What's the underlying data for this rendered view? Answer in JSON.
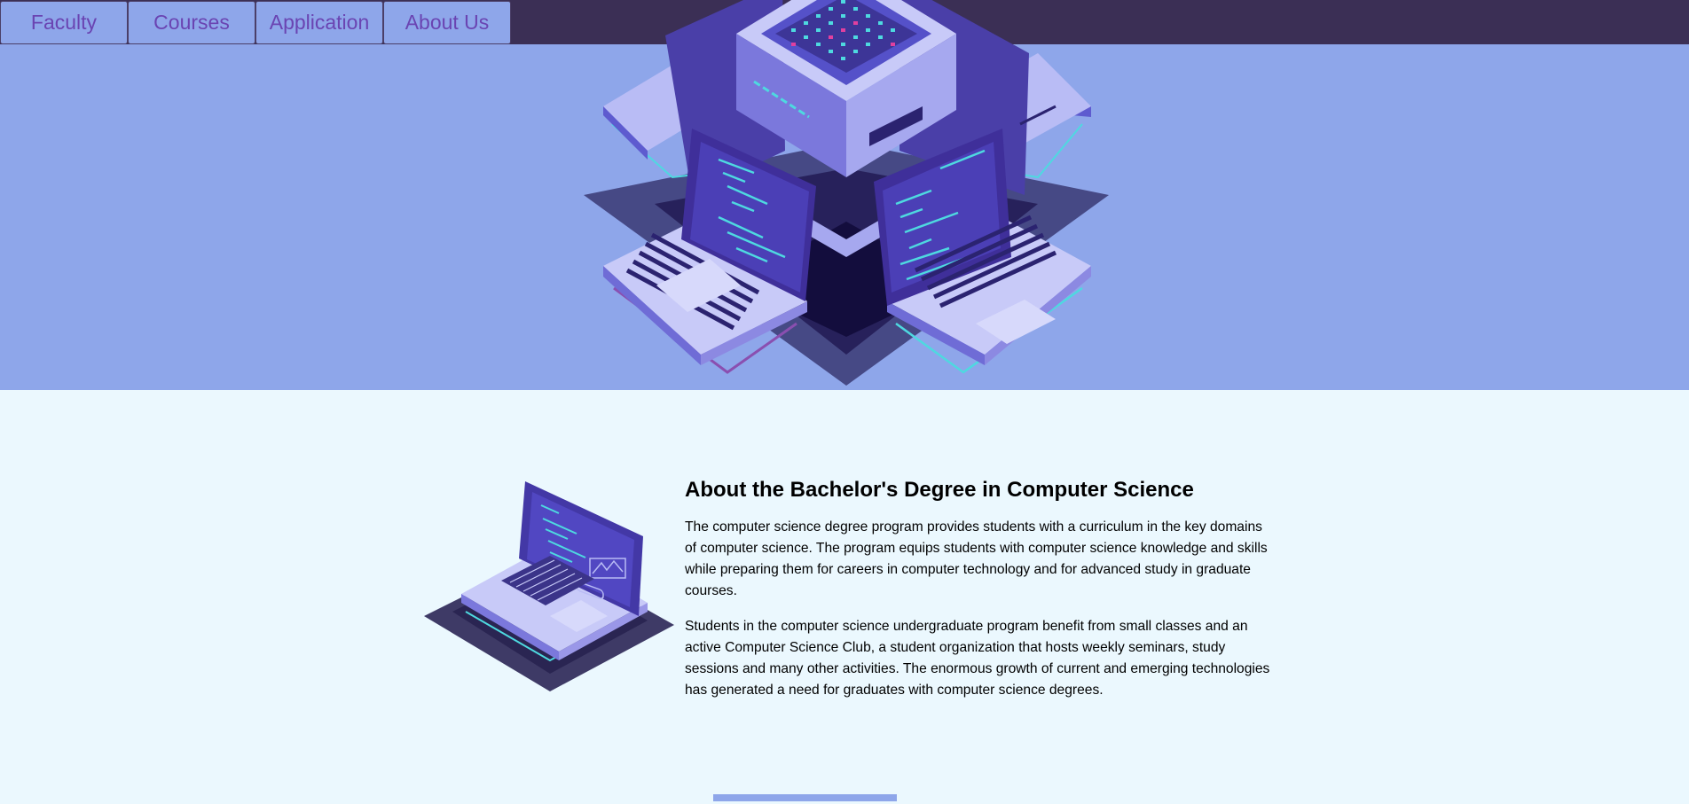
{
  "nav": {
    "items": [
      {
        "label": "Faculty"
      },
      {
        "label": "Courses"
      },
      {
        "label": "Application"
      },
      {
        "label": "About Us"
      }
    ]
  },
  "about": {
    "title": "About the Bachelor's Degree in Computer Science",
    "paragraphs": [
      "The computer science degree program provides students with a curriculum in the key domains of computer science. The program equips students with computer science knowledge and skills while preparing them for careers in computer technology and for advanced study in graduate courses.",
      "Students in the computer science undergraduate program benefit from small classes and an active Computer Science Club, a student organization that hosts weekly seminars, study sessions and many other activities. The enormous growth of current and emerging technologies has generated a need for graduates with computer science degrees."
    ]
  },
  "colors": {
    "nav_bg": "#3b2f55",
    "hero_bg": "#8ea6ea",
    "page_bg": "#ebf8fe",
    "nav_text": "#6a44b2"
  },
  "icons": {
    "hero": "isometric-server-laptops-illustration",
    "about": "isometric-laptop-illustration"
  }
}
